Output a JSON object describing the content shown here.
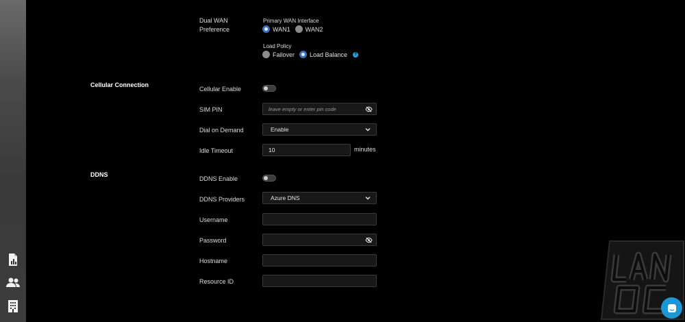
{
  "sidebar": {
    "icons": [
      {
        "name": "report-chart-icon"
      },
      {
        "name": "users-icon"
      },
      {
        "name": "building-icon"
      }
    ]
  },
  "dual_wan": {
    "label": "Dual WAN Preference",
    "primary_interface_label": "Primary WAN Interface",
    "wan1": "WAN1",
    "wan2": "WAN2",
    "selected_interface": "WAN1",
    "load_policy_label": "Load Policy",
    "failover": "Failover",
    "load_balance": "Load Balance",
    "selected_policy": "Load Balance",
    "help_glyph": "?"
  },
  "cellular": {
    "section_title": "Cellular Connection",
    "enable_label": "Cellular Enable",
    "enabled": false,
    "sim_pin_label": "SIM PIN",
    "sim_pin_placeholder": "leave empty or enter pin code",
    "dial_label": "Dial on Demand",
    "dial_value": "Enable",
    "idle_label": "Idle Timeout",
    "idle_value": "10",
    "idle_unit": "minutes"
  },
  "ddns": {
    "section_title": "DDNS",
    "enable_label": "DDNS Enable",
    "enabled": false,
    "providers_label": "DDNS Providers",
    "provider_value": "Azure DNS",
    "username_label": "Username",
    "username_value": "",
    "password_label": "Password",
    "password_value": "",
    "hostname_label": "Hostname",
    "hostname_value": "",
    "resource_label": "Resource ID",
    "resource_value": ""
  },
  "colors": {
    "accent": "#3b6ec2",
    "help": "#28a0e0",
    "chat": "#1b97d5"
  }
}
